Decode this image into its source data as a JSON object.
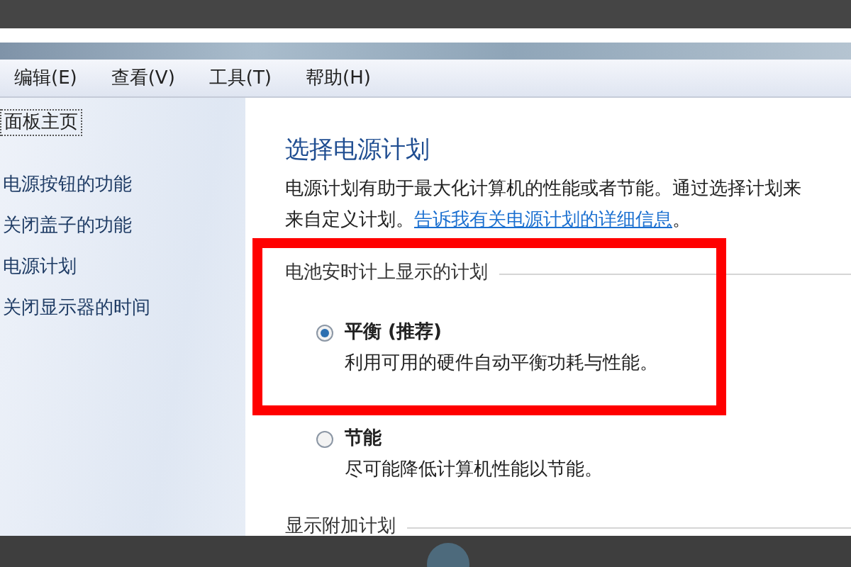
{
  "menu": [
    {
      "label": "编辑(E)"
    },
    {
      "label": "查看(V)"
    },
    {
      "label": "工具(T)"
    },
    {
      "label": "帮助(H)"
    }
  ],
  "sidebar": {
    "items": [
      {
        "label": "面板主页",
        "focused": true
      },
      {
        "label": "电源按钮的功能",
        "focused": false
      },
      {
        "label": "关闭盖子的功能",
        "focused": false
      },
      {
        "label": "电源计划",
        "focused": false
      },
      {
        "label": "关闭显示器的时间",
        "focused": false
      }
    ]
  },
  "main": {
    "title": "选择电源计划",
    "intro": {
      "line_1": "电源计划有助于最大化计算机的性能或者节能。通过选择计划来",
      "line_2": "来自定义计划。",
      "link": "告诉我有关电源计划的详细信息",
      "end": "。"
    },
    "plan_group": {
      "title": "电池安时计上显示的计划",
      "plans": [
        {
          "name": "平衡 (推荐)",
          "description": "利用可用的硬件自动平衡功耗与性能。",
          "selected": true
        },
        {
          "name": "节能",
          "description": "尽可能降低计算机性能以节能。",
          "selected": false
        }
      ]
    },
    "more_plans": {
      "title": "显示附加计划"
    }
  }
}
